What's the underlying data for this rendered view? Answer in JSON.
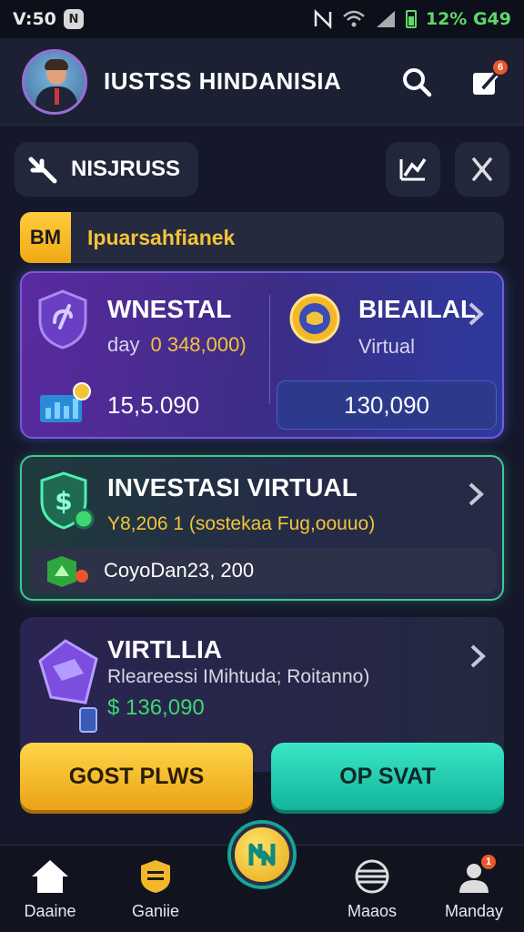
{
  "status": {
    "time": "V:50",
    "notif_badge": "N",
    "battery": "12% G49"
  },
  "header": {
    "title": "IUSTSS HINDANISIA",
    "notification_count": "6"
  },
  "section": {
    "label": "NISJRUSS"
  },
  "banner": {
    "tag": "BM",
    "text": "Ipuarsahfianek"
  },
  "card1": {
    "left": {
      "title": "WNESTAL",
      "sub_label": "day",
      "sub_value": "0 348,000)",
      "amount": "15,5.090"
    },
    "right": {
      "title": "BIEAILAL",
      "sub": "Virtual",
      "amount": "130,090"
    }
  },
  "card2": {
    "title": "INVESTASI VIRTUAL",
    "subtitle": "Y8,206 1 (sostekaa Fug,oouuo)",
    "row_text": "CoyoDan23, 200"
  },
  "card3": {
    "title": "VIRTLLIA",
    "subtitle": "Rleareessi IMihtuda; Roitanno)",
    "amount": "$ 136,090"
  },
  "buttons": {
    "left": "GOST PLWS",
    "right": "OP SVAT"
  },
  "nav": {
    "home": "Daaine",
    "games": "Ganiie",
    "maps": "Maaos",
    "monday": "Manday",
    "monday_badge": "1"
  },
  "colors": {
    "accent_gold": "#f3c43a",
    "accent_teal": "#1fcbb0",
    "accent_purple": "#7a5ad8",
    "positive_green": "#3dd86e"
  }
}
